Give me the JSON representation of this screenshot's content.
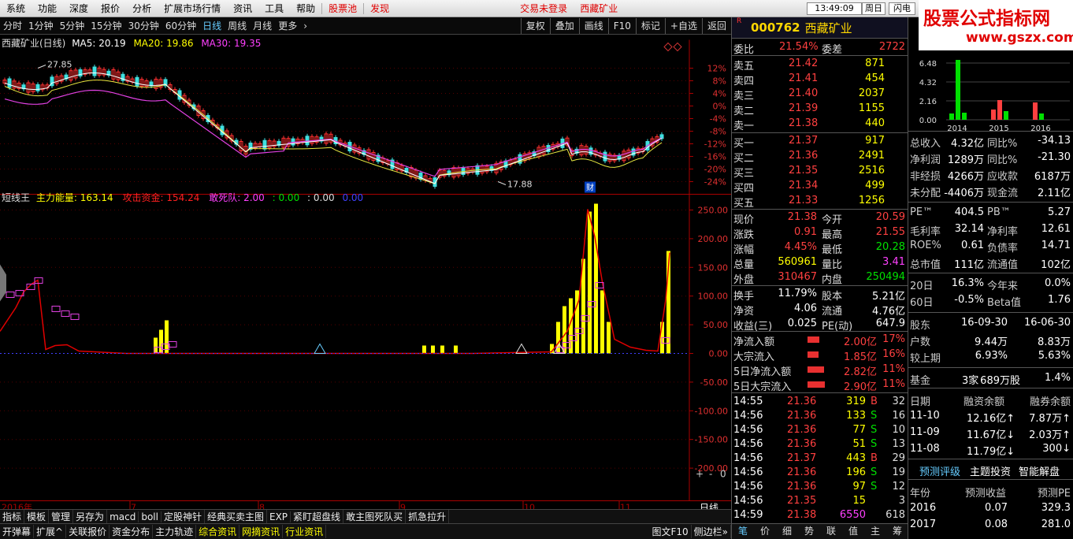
{
  "menubar": {
    "items": [
      "系统",
      "功能",
      "深度",
      "报价",
      "分析",
      "扩展市场行情",
      "资讯",
      "工具",
      "帮助"
    ],
    "stockpool": "股票池",
    "discover": "发现",
    "login_status": "交易未登录",
    "stock_name": "西藏矿业",
    "time": "13:49:09",
    "day": "周日",
    "flash": "闪电手"
  },
  "watermark": {
    "line1": "股票公式指标网",
    "line2": "www.gszx.com.cn"
  },
  "toolbar": {
    "periods": [
      "分时",
      "1分钟",
      "5分钟",
      "15分钟",
      "30分钟",
      "60分钟",
      "日线",
      "周线",
      "月线",
      "更多"
    ],
    "active": "日线",
    "buttons": [
      "复权",
      "叠加",
      "画线",
      "F10",
      "标记",
      "+自选",
      "返回"
    ]
  },
  "main_legend": {
    "title": "西藏矿业(日线)",
    "ma5": "MA5: 20.19",
    "ma20": "MA20: 19.86",
    "ma30": "MA30: 19.35"
  },
  "sub_legend": {
    "name": "短线王",
    "main_energy": "主力能量: 163.14",
    "attack": "攻击资金: 154.24",
    "dare": "敢死队: 2.00",
    "v1": ": 0.00",
    "v2": ": 0.00",
    "v3": "0.00"
  },
  "main_axis": {
    "labels": [
      "12%",
      "8%",
      "4%",
      "0%",
      "-4%",
      "-8%",
      "-12%",
      "-16%",
      "-20%",
      "-24%"
    ]
  },
  "sub_axis": {
    "labels": [
      "250.00",
      "200.00",
      "150.00",
      "100.00",
      "50.00",
      "0.00",
      "-50.00",
      "-100.00",
      "-150.00",
      "-200.00"
    ]
  },
  "annotations": {
    "high": "27.85",
    "low": "17.88",
    "cai": "财"
  },
  "time_axis": {
    "labels": [
      "2016年",
      "7",
      "8",
      "9",
      "10",
      "11"
    ],
    "corner": "日线"
  },
  "zoom": {
    "plus": "+",
    "minus": "-",
    "val": "0"
  },
  "bottom_tabs1": [
    "指标",
    "模板",
    "管理",
    "另存为",
    "macd",
    "boll",
    "定股神针",
    "经典买卖主图",
    "EXP",
    "紧盯超盘线",
    "敢主图死队买",
    "抓急拉升"
  ],
  "bottom_tabs1_active": "管理",
  "bottom_tabs2": [
    "开弹幕",
    "扩展^",
    "关联报价",
    "资金分布",
    "主力轨迹",
    "综合资讯",
    "网摘资讯",
    "行业资讯"
  ],
  "bottom_tabs2_right": [
    "图文F10",
    "侧边栏»"
  ],
  "quote": {
    "code": "000762",
    "name": "西藏矿业",
    "weibi_label": "委比",
    "weibi": "21.54%",
    "weicha_label": "委差",
    "weicha": "2722",
    "sells": [
      {
        "label": "卖五",
        "price": "21.42",
        "vol": "871"
      },
      {
        "label": "卖四",
        "price": "21.41",
        "vol": "454"
      },
      {
        "label": "卖三",
        "price": "21.40",
        "vol": "2037"
      },
      {
        "label": "卖二",
        "price": "21.39",
        "vol": "1155"
      },
      {
        "label": "卖一",
        "price": "21.38",
        "vol": "440"
      }
    ],
    "buys": [
      {
        "label": "买一",
        "price": "21.37",
        "vol": "917"
      },
      {
        "label": "买二",
        "price": "21.36",
        "vol": "2491"
      },
      {
        "label": "买三",
        "price": "21.35",
        "vol": "2516"
      },
      {
        "label": "买四",
        "price": "21.34",
        "vol": "499"
      },
      {
        "label": "买五",
        "price": "21.33",
        "vol": "1256"
      }
    ],
    "stats": [
      {
        "l1": "现价",
        "v1": "21.38",
        "c1": "#ff4040",
        "l2": "今开",
        "v2": "20.59",
        "c2": "#ff4040"
      },
      {
        "l1": "涨跌",
        "v1": "0.91",
        "c1": "#ff4040",
        "l2": "最高",
        "v2": "21.55",
        "c2": "#ff4040"
      },
      {
        "l1": "涨幅",
        "v1": "4.45%",
        "c1": "#ff4040",
        "l2": "最低",
        "v2": "20.28",
        "c2": "#00e000"
      },
      {
        "l1": "总量",
        "v1": "560961",
        "c1": "#ffff00",
        "l2": "量比",
        "v2": "3.41",
        "c2": "#ff40ff"
      },
      {
        "l1": "外盘",
        "v1": "310467",
        "c1": "#ff4040",
        "l2": "内盘",
        "v2": "250494",
        "c2": "#00e000"
      }
    ],
    "stats2": [
      {
        "l1": "换手",
        "v1": "11.79%",
        "l2": "股本",
        "v2": "5.21亿"
      },
      {
        "l1": "净资",
        "v1": "4.06",
        "l2": "流通",
        "v2": "4.76亿"
      },
      {
        "l1": "收益(三)",
        "v1": "0.025",
        "l2": "PE(动)",
        "v2": "647.9"
      }
    ],
    "flows": [
      {
        "label": "净流入额",
        "val": "2.00亿",
        "pct": "17%",
        "bar": 0.55
      },
      {
        "label": "大宗流入",
        "val": "1.85亿",
        "pct": "16%",
        "bar": 0.5
      },
      {
        "label": "5日净流入额",
        "val": "2.82亿",
        "pct": "11%",
        "bar": 0.75
      },
      {
        "label": "5日大宗流入",
        "val": "2.90亿",
        "pct": "11%",
        "bar": 0.78
      }
    ],
    "ticks": [
      {
        "t": "14:55",
        "p": "21.36",
        "v": "319",
        "d": "B",
        "n": "32"
      },
      {
        "t": "14:56",
        "p": "21.36",
        "v": "133",
        "d": "S",
        "n": "16"
      },
      {
        "t": "14:56",
        "p": "21.36",
        "v": "77",
        "d": "S",
        "n": "10"
      },
      {
        "t": "14:56",
        "p": "21.36",
        "v": "51",
        "d": "S",
        "n": "13"
      },
      {
        "t": "14:56",
        "p": "21.37",
        "v": "443",
        "d": "B",
        "n": "29"
      },
      {
        "t": "14:56",
        "p": "21.36",
        "v": "196",
        "d": "S",
        "n": "19"
      },
      {
        "t": "14:56",
        "p": "21.36",
        "v": "97",
        "d": "S",
        "n": "12"
      },
      {
        "t": "14:56",
        "p": "21.35",
        "v": "15",
        "d": "",
        "n": "3"
      },
      {
        "t": "14:59",
        "p": "21.38",
        "v": "6550",
        "d": "",
        "n": "618"
      }
    ],
    "bottom_tabs": [
      "笔",
      "价",
      "细",
      "势",
      "联",
      "值",
      "主",
      "筹"
    ]
  },
  "fin": {
    "chart_years": [
      "2014",
      "2015",
      "2016"
    ],
    "chart_ticks": [
      "6.48",
      "4.32",
      "2.16",
      "0.00"
    ],
    "rows1": [
      {
        "l1": "总收入",
        "v1": "4.32亿",
        "l2": "同比%",
        "v2": "-34.13"
      },
      {
        "l1": "净利润",
        "v1": "1289万",
        "l2": "同比%",
        "v2": "-21.30"
      },
      {
        "l1": "非经损",
        "v1": "4266万",
        "l2": "应收款",
        "v2": "6187万"
      },
      {
        "l1": "未分配",
        "v1": "-4406万",
        "l2": "现金流",
        "v2": "2.11亿"
      }
    ],
    "rows2": [
      {
        "l1": "PE™",
        "v1": "404.5",
        "l2": "PB™",
        "v2": "5.27"
      },
      {
        "l1": "毛利率",
        "v1": "32.14",
        "l2": "净利率",
        "v2": "12.61"
      },
      {
        "l1": "ROE%",
        "v1": "0.61",
        "l2": "负债率",
        "v2": "14.71"
      },
      {
        "l1": "总市值",
        "v1": "111亿",
        "l2": "流通值",
        "v2": "102亿"
      }
    ],
    "rows3": [
      {
        "l1": "20日",
        "v1": "16.3%",
        "l2": "今年来",
        "v2": "0.0%"
      },
      {
        "l1": "60日",
        "v1": "-0.5%",
        "l2": "Beta值",
        "v2": "1.76"
      }
    ],
    "holders": {
      "l": "股东",
      "d1": "16-09-30",
      "d2": "16-06-30"
    },
    "rows4": [
      {
        "l1": "户数",
        "v1": "9.44万",
        "v2": "8.83万"
      },
      {
        "l1": "较上期",
        "v1": "6.93%",
        "v2": "5.63%"
      }
    ],
    "fund": {
      "l": "基金",
      "v1": "3家",
      "v2": "689万股",
      "v3": "1.4%"
    },
    "margin_head": [
      "日期",
      "融资余额",
      "融券余额"
    ],
    "margin": [
      {
        "d": "11-10",
        "a": "12.16亿↑",
        "b": "7.87万↑"
      },
      {
        "d": "11-09",
        "a": "11.67亿↓",
        "b": "2.03万↑"
      },
      {
        "d": "11-08",
        "a": "11.79亿↓",
        "b": "300↓"
      }
    ],
    "tabs": [
      "预测评级",
      "主题投资",
      "智能解盘"
    ],
    "forecast_head": [
      "年份",
      "预测收益",
      "预测PE"
    ],
    "forecast": [
      {
        "y": "2016",
        "e": "0.07",
        "pe": "329.3"
      },
      {
        "y": "2017",
        "e": "0.08",
        "pe": "281.0"
      }
    ]
  },
  "chart_data": {
    "type": "candlestick",
    "profit_bars": {
      "years": [
        "2014",
        "2015",
        "2016"
      ],
      "bars": [
        {
          "year": "2014",
          "values": [
            0.8,
            7.6,
            0.9
          ],
          "colors": [
            "#00e000",
            "#00e000",
            "#00e000"
          ]
        },
        {
          "year": "2015",
          "values": [
            1.3,
            2.5,
            1.1
          ],
          "colors": [
            "#ff4040",
            "#ff4040",
            "#00e000"
          ]
        },
        {
          "year": "2016",
          "values": [
            2.2,
            0.8,
            0
          ],
          "colors": [
            "#ff4040",
            "#00e000",
            "#00e000"
          ]
        }
      ]
    }
  }
}
